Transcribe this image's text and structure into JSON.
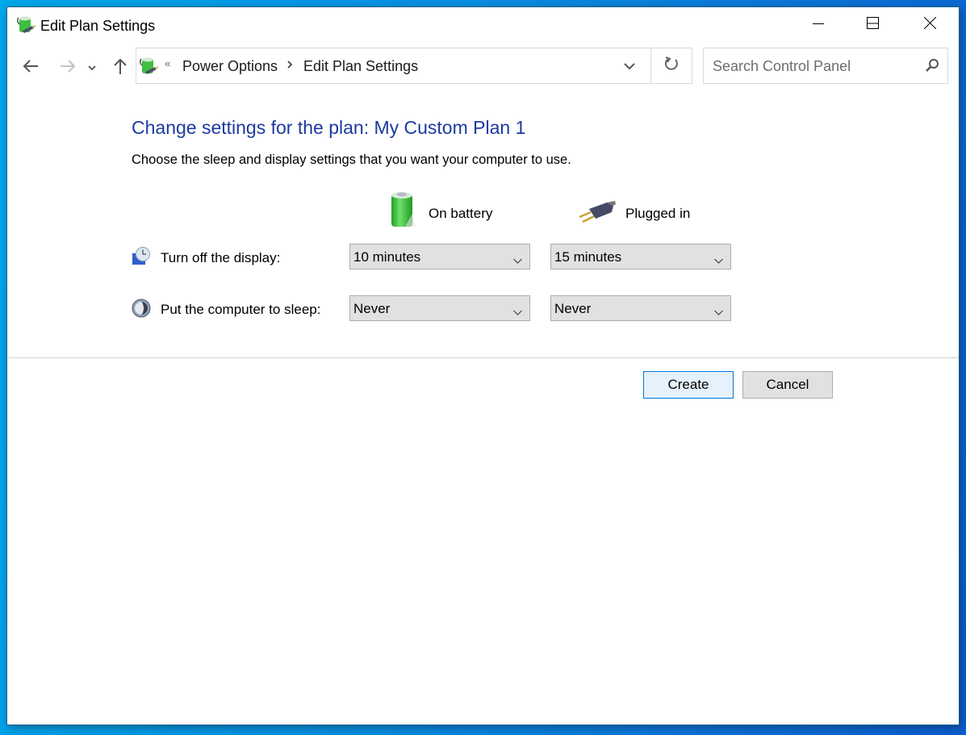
{
  "window": {
    "title": "Edit Plan Settings",
    "controls": {
      "minimize": "minimize",
      "maximize": "maximize",
      "close": "close"
    }
  },
  "navigation": {
    "back_icon": "arrow-left-icon",
    "forward_icon": "arrow-right-icon",
    "recent_icon": "chevron-down-icon",
    "up_icon": "arrow-up-icon",
    "breadcrumb_overflow": "«",
    "breadcrumbs": [
      {
        "label": "Power Options"
      },
      {
        "label": "Edit Plan Settings"
      }
    ],
    "search": {
      "placeholder": "Search Control Panel",
      "value": ""
    }
  },
  "main": {
    "heading": "Change settings for the plan: My Custom Plan 1",
    "description": "Choose the sleep and display settings that you want your computer to use.",
    "columns": [
      {
        "label": "On battery",
        "icon": "battery-icon"
      },
      {
        "label": "Plugged in",
        "icon": "power-plug-icon"
      }
    ],
    "settings": [
      {
        "label": "Turn off the display:",
        "icon": "display-clock-icon",
        "on_battery": "10 minutes",
        "plugged_in": "15 minutes"
      },
      {
        "label": "Put the computer to sleep:",
        "icon": "sleep-moon-icon",
        "on_battery": "Never",
        "plugged_in": "Never"
      }
    ]
  },
  "buttons": {
    "create": "Create",
    "cancel": "Cancel"
  },
  "colors": {
    "heading": "#1e3a9f",
    "primary_button_border": "#0078d7",
    "primary_button_bg": "#e5f1fb"
  }
}
